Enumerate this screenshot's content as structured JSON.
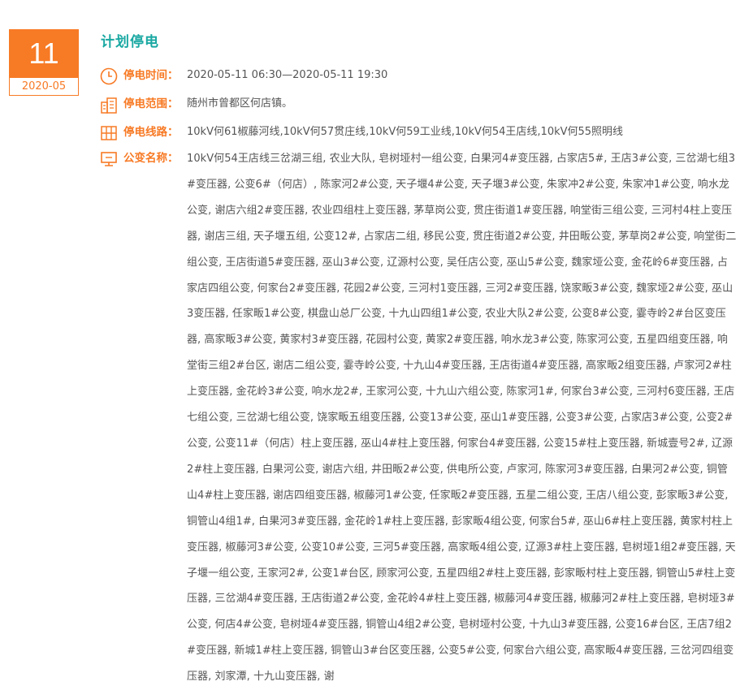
{
  "date": {
    "day": "11",
    "month": "2020-05"
  },
  "title": "计划停电",
  "time": {
    "label": "停电时间：",
    "value": "2020-05-11 06:30—2020-05-11 19:30"
  },
  "scope": {
    "label": "停电范围：",
    "value": "随州市曾都区何店镇。"
  },
  "lines": {
    "label": "停电线路：",
    "value": "10kV何61椒藤河线,10kV何57贯庄线,10kV何59工业线,10kV何54王店线,10kV何55照明线"
  },
  "transformers": {
    "label": "公变名称：",
    "value": "10kV何54王店线三岔湖三组, 农业大队, 皂树垭村一组公变, 白果河4#变压器, 占家店5#, 王店3#公变, 三岔湖七组3#变压器, 公变6#（何店）, 陈家河2#公变, 天子堰4#公变, 天子堰3#公变, 朱家冲2#公变, 朱家冲1#公变, 响水龙公变, 谢店六组2#变压器, 农业四组柱上变压器, 茅草岗公变, 贯庄街道1#变压器, 响堂街三组公变, 三河村4柱上变压器, 谢店三组, 天子堰五组, 公变12#, 占家店二组, 移民公变, 贯庄街道2#公变, 井田畈公变, 茅草岗2#公变, 响堂街二组公变, 王店街道5#变压器, 巫山3#公变, 辽源村公变, 吴任店公变, 巫山5#公变, 魏家垭公变, 金花岭6#变压器, 占家店四组公变, 何家台2#变压器, 花园2#公变, 三河村1变压器, 三河2#变压器, 饶家畈3#公变, 魏家垭2#公变, 巫山3变压器, 任家畈1#公变, 棋盘山总厂公变, 十九山四组1#公变, 农业大队2#公变, 公变8#公变, 霎寺岭2#台区变压器, 高家畈3#公变, 黄家村3#变压器, 花园村公变, 黄家2#变压器, 响水龙3#公变, 陈家河公变, 五星四组变压器, 响堂街三组2#台区, 谢店二组公变, 霎寺岭公变, 十九山4#变压器, 王店街道4#变压器, 高家畈2组变压器, 卢家河2#柱上变压器, 金花岭3#公变, 响水龙2#, 王家河公变, 十九山六组公变, 陈家河1#, 何家台3#公变, 三河村6变压器, 王店七组公变, 三岔湖七组公变, 饶家畈五组变压器, 公变13#公变, 巫山1#变压器, 公变3#公变, 占家店3#公变, 公变2#公变, 公变11#（何店）柱上变压器, 巫山4#柱上变压器, 何家台4#变压器, 公变15#柱上变压器, 新城壹号2#, 辽源2#柱上变压器, 白果河公变, 谢店六组, 井田畈2#公变, 供电所公变, 卢家河, 陈家河3#变压器, 白果河2#公变, 铜管山4#柱上变压器, 谢店四组变压器, 椒藤河1#公变, 任家畈2#变压器, 五星二组公变, 王店八组公变, 彭家畈3#公变, 铜管山4组1#, 白果河3#变压器, 金花岭1#柱上变压器, 彭家畈4组公变, 何家台5#, 巫山6#柱上变压器, 黄家村柱上变压器, 椒藤河3#公变, 公变10#公变, 三河5#变压器, 高家畈4组公变, 辽源3#柱上变压器, 皂树垭1组2#变压器, 天子堰一组公变, 王家河2#, 公变1#台区, 顾家河公变, 五星四组2#柱上变压器, 彭家畈村柱上变压器, 铜管山5#柱上变压器, 三岔湖4#变压器, 王店街道2#公变, 金花岭4#柱上变压器, 椒藤河4#变压器, 椒藤河2#柱上变压器, 皂树垭3#公变, 何店4#公变, 皂树垭4#变压器, 铜管山4组2#公变, 皂树垭村公变, 十九山3#变压器, 公变16#台区, 王店7组2#变压器, 新城1#柱上变压器, 铜管山3#台区变压器, 公变5#公变, 何家台六组公变, 高家畈4#变压器, 三岔河四组变压器, 刘家潭, 十九山变压器, 谢"
  },
  "colors": {
    "accent": "#f77a25",
    "title": "#1aa8a2",
    "text": "#555555"
  },
  "icons": {
    "time": "clock-icon",
    "scope": "building-icon",
    "lines": "grid-icon",
    "transformers": "monitor-icon"
  }
}
